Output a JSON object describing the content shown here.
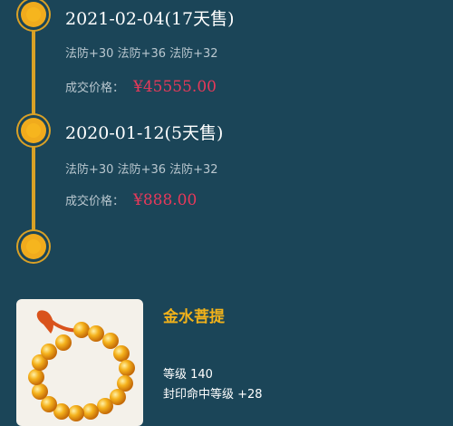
{
  "trade_history": [
    {
      "date": "2021-02-04(17天售)",
      "attributes": "法防+30 法防+36 法防+32",
      "price_label": "成交价格：",
      "price": "¥45555.00"
    },
    {
      "date": "2020-01-12(5天售)",
      "attributes": "法防+30 法防+36 法防+32",
      "price_label": "成交价格：",
      "price": "¥888.00"
    }
  ],
  "item": {
    "name": "金水菩提",
    "level": "等级 140",
    "seal_hit_level": "封印命中等级 +28"
  },
  "colors": {
    "background": "#1b4558",
    "timeline_gold": "#d9a126",
    "price_red": "#e7395a",
    "item_name_gold": "#f2b21a"
  }
}
